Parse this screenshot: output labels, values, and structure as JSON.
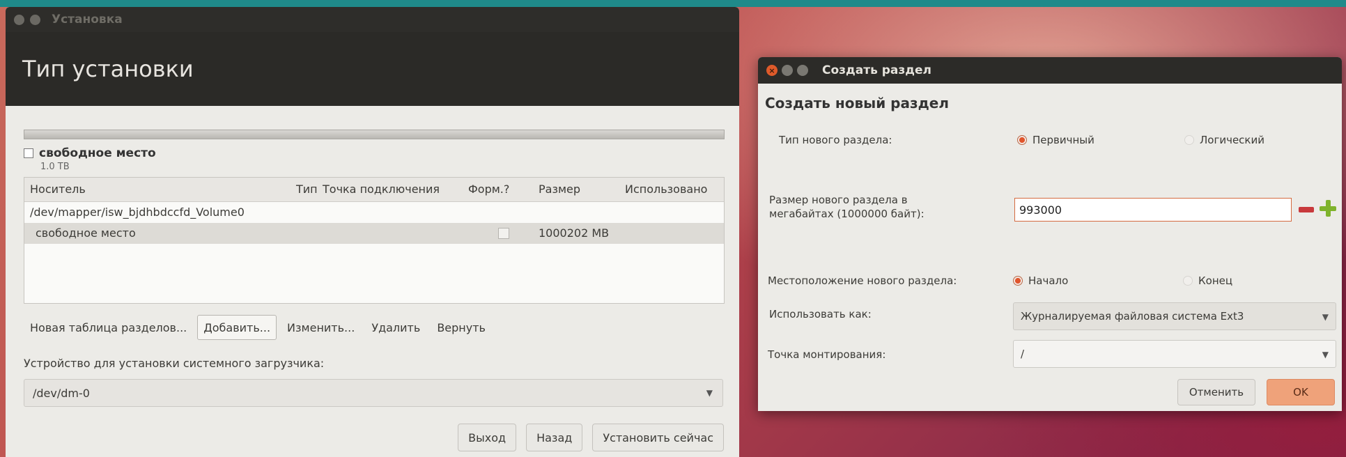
{
  "installer": {
    "window_title": "Установка",
    "heading": "Тип установки",
    "free_space": {
      "label": "свободное место",
      "size": "1.0 TB"
    },
    "table": {
      "columns": [
        "Носитель",
        "Тип",
        "Точка подключения",
        "Форм.?",
        "Размер",
        "Использовано"
      ],
      "rows": [
        {
          "device": "/dev/mapper/isw_bjdhbdccfd_Volume0",
          "type": "",
          "mount": "",
          "format": false,
          "size": "",
          "used": ""
        },
        {
          "device": "свободное место",
          "type": "",
          "mount": "",
          "format": false,
          "size": "1000202 MB",
          "used": "",
          "selected": true
        }
      ]
    },
    "table_buttons": {
      "new_table": "Новая таблица разделов...",
      "add": "Добавить...",
      "change": "Изменить...",
      "delete": "Удалить",
      "revert": "Вернуть"
    },
    "bootloader": {
      "label": "Устройство для установки системного загрузчика:",
      "value": "/dev/dm-0"
    },
    "buttons": {
      "quit": "Выход",
      "back": "Назад",
      "install": "Установить сейчас"
    }
  },
  "dialog": {
    "title": "Создать раздел",
    "heading": "Создать новый раздел",
    "type": {
      "label": "Тип нового раздела:",
      "primary": "Первичный",
      "logical": "Логический",
      "selected": "primary"
    },
    "size": {
      "label_line1": "Размер нового раздела в",
      "label_line2": "мегабайтах (1000000 байт):",
      "value": "993000"
    },
    "location": {
      "label": "Местоположение нового раздела:",
      "begin": "Начало",
      "end": "Конец",
      "selected": "begin"
    },
    "use_as": {
      "label": "Использовать как:",
      "value": "Журналируемая файловая система Ext3"
    },
    "mount": {
      "label": "Точка монтирования:",
      "value": "/"
    },
    "buttons": {
      "cancel": "Отменить",
      "ok": "OK"
    }
  },
  "colors": {
    "accent": "#dd4814",
    "titlebar": "#2c2b28",
    "ok_button": "#efa27a",
    "desktop": "#b8474a"
  }
}
